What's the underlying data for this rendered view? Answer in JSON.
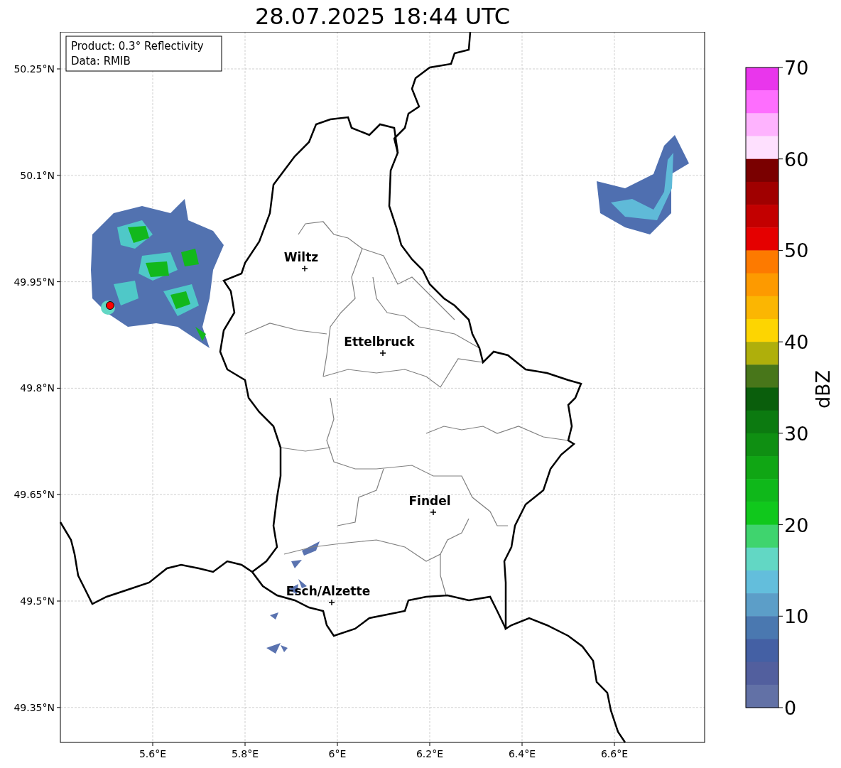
{
  "title": "28.07.2025 18:44 UTC",
  "info_box": [
    "Product: 0.3° Reflectivity",
    "Data: RMIB"
  ],
  "map": {
    "x_axis_labels": [
      "5.6°E",
      "5.8°E",
      "6°E",
      "6.2°E",
      "6.4°E",
      "6.6°E"
    ],
    "y_axis_labels": [
      "50.25°N",
      "50.1°N",
      "49.95°N",
      "49.8°N",
      "49.65°N",
      "49.5°N",
      "49.35°N"
    ],
    "places": [
      {
        "name": "Wiltz"
      },
      {
        "name": "Ettelbruck"
      },
      {
        "name": "Findel"
      },
      {
        "name": "Esch/Alzette"
      }
    ]
  },
  "colorbar": {
    "label": "dBZ",
    "ticks": [
      "70",
      "60",
      "50",
      "40",
      "30",
      "20",
      "10",
      "0"
    ],
    "bins": [
      {
        "color": "#e936ec"
      },
      {
        "color": "#fe6efe"
      },
      {
        "color": "#feb3fe"
      },
      {
        "color": "#fee0fe"
      },
      {
        "color": "#7a0000"
      },
      {
        "color": "#a00000"
      },
      {
        "color": "#c30000"
      },
      {
        "color": "#e50000"
      },
      {
        "color": "#fd7a00"
      },
      {
        "color": "#fd9a00"
      },
      {
        "color": "#fbb602"
      },
      {
        "color": "#fdd501"
      },
      {
        "color": "#afaf0b"
      },
      {
        "color": "#48761a"
      },
      {
        "color": "#0a5e0c"
      },
      {
        "color": "#0c7a10"
      },
      {
        "color": "#0f8f12"
      },
      {
        "color": "#10a614"
      },
      {
        "color": "#0fb81a"
      },
      {
        "color": "#10c81c"
      },
      {
        "color": "#3fd46e"
      },
      {
        "color": "#62d7c4"
      },
      {
        "color": "#63bedc"
      },
      {
        "color": "#5c9ec8"
      },
      {
        "color": "#4a78b0"
      },
      {
        "color": "#4460a4"
      },
      {
        "color": "#525f9e"
      },
      {
        "color": "#6271a6"
      }
    ]
  }
}
